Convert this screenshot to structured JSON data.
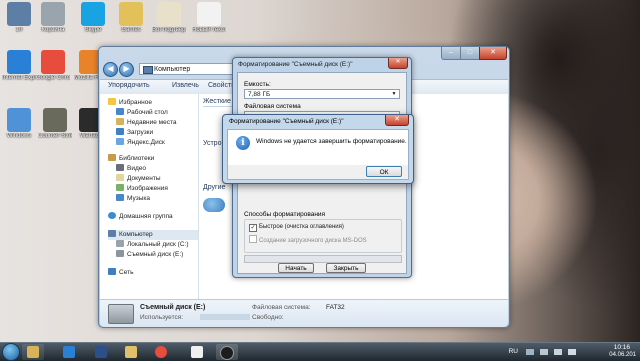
{
  "desktop": {
    "icons": [
      {
        "label": "10",
        "color": "#5d7fa6"
      },
      {
        "label": "Корзина",
        "color": "#9aa4ad"
      },
      {
        "label": "Skype",
        "color": "#1aa3e3"
      },
      {
        "label": "Games",
        "color": "#e3c15a"
      },
      {
        "label": "Bot-подтвер...",
        "color": "#e8e0c8"
      },
      {
        "label": "Новый текстовый...",
        "color": "#f2f2f2"
      },
      {
        "label": "Internet Explorer",
        "color": "#2a7fd6"
      },
      {
        "label": "Google Chrome",
        "color": "#e84c3d"
      },
      {
        "label": "Mozilla Firefox",
        "color": "#e9832a"
      },
      {
        "label": "Windows",
        "color": "#4f92d8"
      },
      {
        "label": "Counter-Strike",
        "color": "#6a6a5c"
      },
      {
        "label": "Warface",
        "color": "#2b2b2b"
      }
    ]
  },
  "explorer": {
    "address": "Компьютер",
    "toolbar": [
      "Упорядочить",
      "Извлечь",
      "Свойства системы"
    ],
    "nav": {
      "favorites": "Избранное",
      "favorites_items": [
        "Рабочий стол",
        "Недавние места",
        "Загрузки",
        "Яндекс.Диск"
      ],
      "libraries": "Библиотеки",
      "libraries_items": [
        "Видео",
        "Документы",
        "Изображения",
        "Музыка"
      ],
      "homegroup": "Домашняя группа",
      "computer": "Компьютер",
      "computer_items": [
        "Локальный диск (C:)",
        "Съемный диск (E:)"
      ],
      "network": "Сеть"
    },
    "content": {
      "hard_disks": "Жесткие д",
      "devices": "Устрой",
      "other": "Другие"
    },
    "details": {
      "name": "Съемный диск (E:)",
      "used_label": "Используется:",
      "free_label": "Свободно:",
      "fs_label": "Файловая система:",
      "fs_value": "FAT32"
    }
  },
  "format_dialog": {
    "title": "Форматирование \"Съемный диск (E:)\"",
    "capacity_label": "Емкость:",
    "capacity_value": "7,88 ГБ",
    "fs_label": "Файловая система",
    "methods_label": "Способы форматирования",
    "quick_format": "Быстрое (очистка оглавления)",
    "msdos_disk": "Создание загрузочного диска MS-DOS",
    "start_button": "Начать",
    "close_button": "Закрыть"
  },
  "message_box": {
    "title": "Форматирование \"Съемный диск (E:)\"",
    "text": "Windows не удается завершить форматирование.",
    "ok": "ОК",
    "info_glyph": "i",
    "close_glyph": "✕"
  },
  "taskbar": {
    "language": "RU",
    "time": "10:16",
    "date": "04.06.201"
  }
}
